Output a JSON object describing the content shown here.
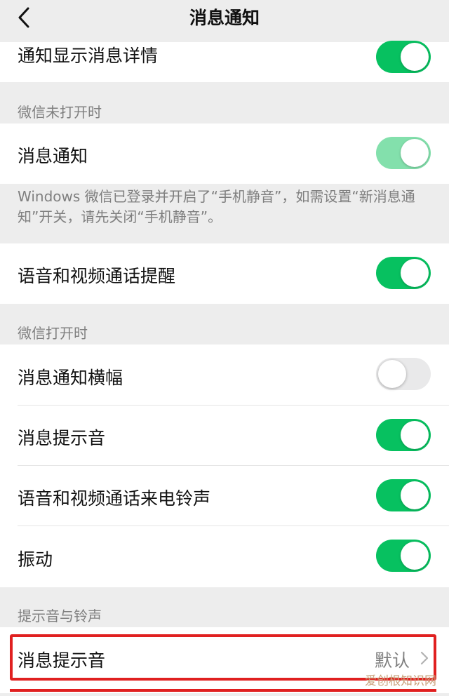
{
  "header": {
    "title": "消息通知"
  },
  "rows": {
    "show_detail": {
      "label": "通知显示消息详情",
      "enabled": true
    },
    "msg_notify": {
      "label": "消息通知",
      "enabled": true
    },
    "voice_video_remind": {
      "label": "语音和视频通话提醒",
      "enabled": true
    },
    "banner": {
      "label": "消息通知横幅",
      "enabled": false
    },
    "msg_sound": {
      "label": "消息提示音",
      "enabled": true
    },
    "ringtone": {
      "label": "语音和视频通话来电铃声",
      "enabled": true
    },
    "vibrate": {
      "label": "振动",
      "enabled": true
    },
    "sound_select": {
      "label": "消息提示音",
      "value": "默认"
    }
  },
  "sections": {
    "wechat_closed": "微信未打开时",
    "wechat_open": "微信打开时",
    "sounds": "提示音与铃声"
  },
  "notes": {
    "windows_notice": "Windows 微信已登录并开启了“手机静音”，如需设置“新消息通知”开关，请先关闭“手机静音”。"
  },
  "watermark": "爱创根知识网",
  "colors": {
    "accent": "#07c160",
    "accent_disabled": "#83e0ac",
    "highlight": "#e02020",
    "background": "#ededed"
  },
  "icons": {
    "back": "chevron-left-icon",
    "disclosure": "chevron-right-icon"
  }
}
